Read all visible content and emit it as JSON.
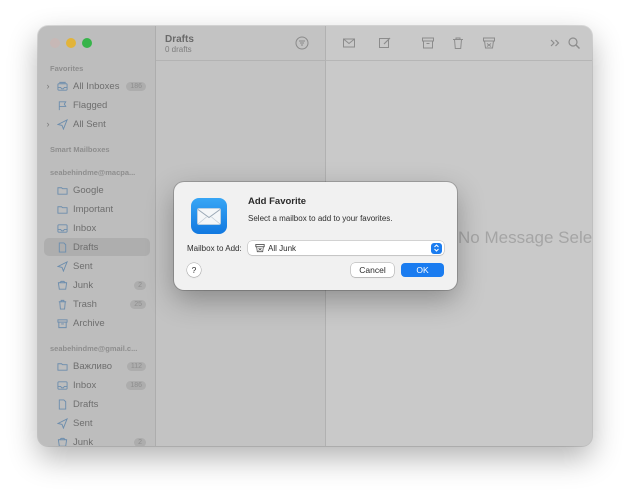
{
  "sidebar": {
    "sections": {
      "favorites": "Favorites",
      "smart": "Smart Mailboxes",
      "account1": "seabehindme@macpa...",
      "account2": "seabehindme@gmail.c..."
    },
    "favorites": [
      {
        "label": "All Inboxes",
        "badge": "186"
      },
      {
        "label": "Flagged"
      },
      {
        "label": "All Sent"
      }
    ],
    "account1": [
      {
        "label": "Google"
      },
      {
        "label": "Important"
      },
      {
        "label": "Inbox"
      },
      {
        "label": "Drafts"
      },
      {
        "label": "Sent"
      },
      {
        "label": "Junk",
        "badge": "2"
      },
      {
        "label": "Trash",
        "badge": "25"
      },
      {
        "label": "Archive"
      }
    ],
    "account2": [
      {
        "label": "Важливо",
        "badge": "112"
      },
      {
        "label": "Inbox",
        "badge": "186"
      },
      {
        "label": "Drafts"
      },
      {
        "label": "Sent"
      },
      {
        "label": "Junk",
        "badge": "2"
      }
    ]
  },
  "list": {
    "title": "Drafts",
    "subtitle": "0 drafts"
  },
  "content": {
    "empty_text": "No Message Selected"
  },
  "dialog": {
    "title": "Add Favorite",
    "message": "Select a mailbox to add to your favorites.",
    "field_label": "Mailbox to Add:",
    "selected_mailbox": "All Junk",
    "help": "?",
    "cancel": "Cancel",
    "ok": "OK"
  },
  "colors": {
    "accent": "#1a7cf0",
    "sidebar_icon": "#6c8dad"
  }
}
